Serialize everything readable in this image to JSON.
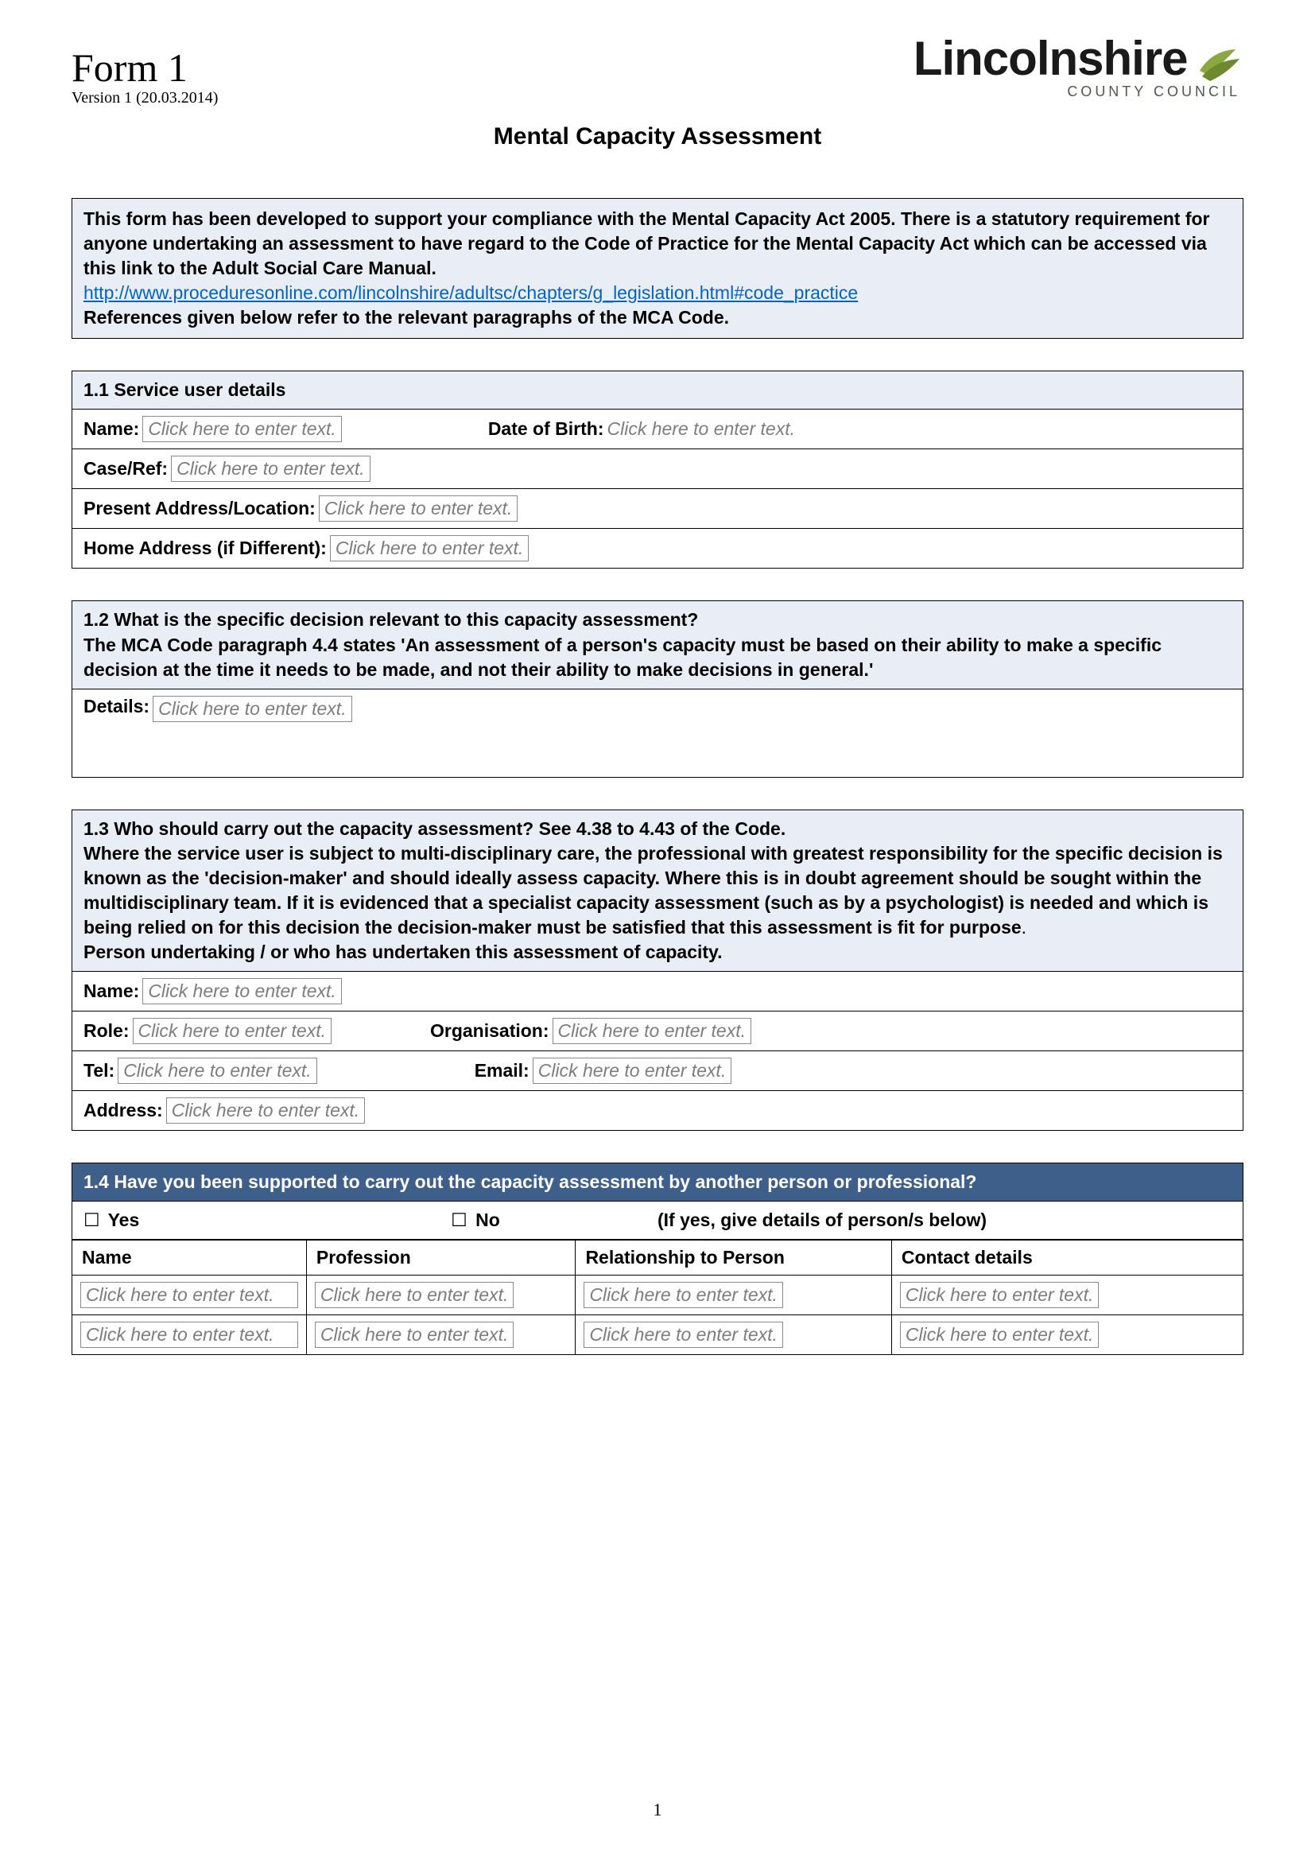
{
  "header": {
    "form_title": "Form 1",
    "version": "Version 1 (20.03.2014)",
    "logo_word": "Lincolnshire",
    "logo_sub": "COUNTY COUNCIL"
  },
  "doc_title": "Mental Capacity Assessment",
  "intro": {
    "p1": "This form has been developed to support your compliance with the Mental Capacity Act 2005. There is a statutory requirement for anyone undertaking an assessment to have regard to the Code of Practice for the Mental Capacity Act which can be accessed via this link to the Adult Social Care Manual.",
    "link": "http://www.proceduresonline.com/lincolnshire/adultsc/chapters/g_legislation.html#code_practice",
    "p2": "References given below refer to the relevant paragraphs of the MCA Code."
  },
  "placeholder": "Click here to enter text.",
  "s11": {
    "heading": "1.1 Service user details",
    "name_label": "Name:",
    "dob_label": "Date of Birth:",
    "case_label": "Case/Ref:",
    "present_label": "Present Address/Location:",
    "home_label": "Home Address (if Different):"
  },
  "s12": {
    "heading": "1.2 What is the specific decision relevant to this capacity assessment?",
    "body": "The MCA Code paragraph 4.4 states 'An assessment of a person's capacity must be based on their ability to make a specific decision at the time it needs to be made, and not their ability to make decisions in general.'",
    "details_label": "Details:"
  },
  "s13": {
    "heading": "1.3 Who should carry out the capacity assessment? See 4.38 to 4.43 of the Code.",
    "body1": "Where the service user is subject to multi-disciplinary care, the professional with greatest responsibility for the specific decision is known as the 'decision-maker' and should ideally assess capacity. Where this is in doubt agreement should be sought within the multidisciplinary team. If it is evidenced that a specialist capacity assessment (such as by a psychologist) is needed and which is being relied on for this decision the decision-maker must be satisfied that this assessment is fit for purpose",
    "body2": "Person undertaking / or who has undertaken this assessment of capacity.",
    "name_label": "Name:",
    "role_label": "Role:",
    "org_label": "Organisation:",
    "tel_label": "Tel:",
    "email_label": "Email:",
    "address_label": "Address:"
  },
  "s14": {
    "heading": "1.4 Have you been supported to carry out the capacity assessment by another person or professional?",
    "yes": "Yes",
    "no": "No",
    "hint": "(If yes, give details of person/s below)",
    "cols": {
      "name": "Name",
      "profession": "Profession",
      "relationship": "Relationship to Person",
      "contact": "Contact details"
    }
  },
  "page_number": "1"
}
